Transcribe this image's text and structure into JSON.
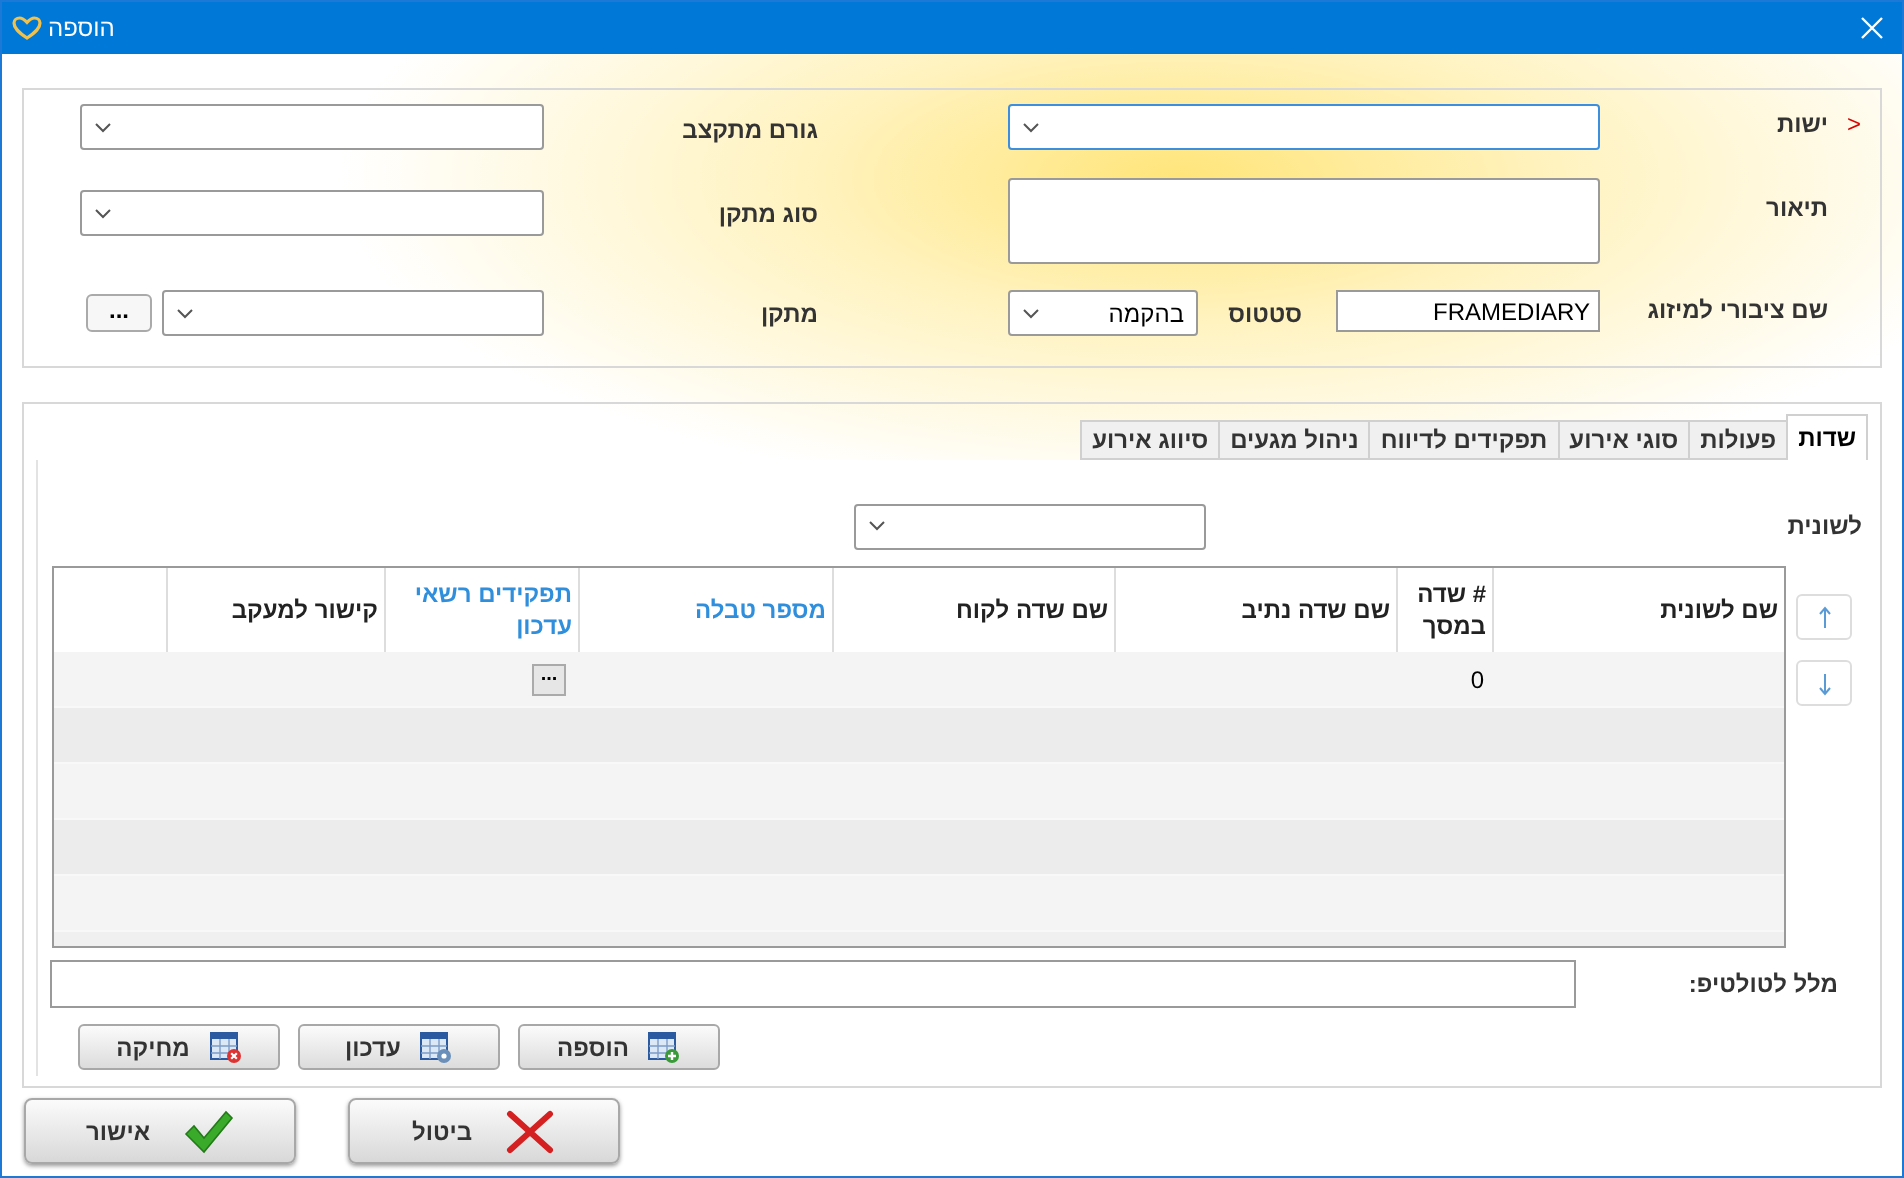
{
  "window": {
    "title": "הוספה"
  },
  "form": {
    "entity": {
      "label": "ישות",
      "marker": "<",
      "focused": true
    },
    "budget_factor": {
      "label": "גורם מתקצב"
    },
    "description": {
      "label": "תיאור"
    },
    "facility_type": {
      "label": "סוג מתקן"
    },
    "public_name": {
      "label": "שם ציבורי למיזוג",
      "value": "FRAMEDIARY"
    },
    "status": {
      "label": "סטטוס",
      "value": "בהקמה"
    },
    "facility": {
      "label": "מתקן",
      "browse": "..."
    }
  },
  "tabs": [
    {
      "label": "שדות",
      "selected": true
    },
    {
      "label": "פעולות",
      "selected": false
    },
    {
      "label": "סוגי אירוע",
      "selected": false
    },
    {
      "label": "תפקידים לדיווח",
      "selected": false
    },
    {
      "label": "ניהול מגעים",
      "selected": false
    },
    {
      "label": "סיווג אירוע",
      "selected": false
    }
  ],
  "tab_filter": {
    "label": "לשונית"
  },
  "grid": {
    "columns": [
      {
        "label": "שם לשונית",
        "color": "#222222"
      },
      {
        "label": "# שדה במסך",
        "color": "#222222"
      },
      {
        "label": "שם שדה נתיב",
        "color": "#222222"
      },
      {
        "label": "שם שדה לקוח",
        "color": "#222222"
      },
      {
        "label": "מספר טבלה",
        "color": "#2f8fdc"
      },
      {
        "label": "תפקידים רשאי עדכון",
        "color": "#2f8fdc"
      },
      {
        "label": "קישור למעקב",
        "color": "#222222"
      }
    ],
    "rows": [
      {
        "kind": "data",
        "cells": [
          {
            "kind": "blank"
          },
          {
            "kind": "text",
            "text": "0"
          },
          {
            "kind": "blank"
          },
          {
            "kind": "blank"
          },
          {
            "kind": "blank"
          },
          {
            "kind": "button",
            "text": "..."
          },
          {
            "kind": "blank"
          }
        ]
      },
      {
        "kind": "empty"
      },
      {
        "kind": "empty"
      },
      {
        "kind": "empty"
      },
      {
        "kind": "empty"
      }
    ]
  },
  "tooltip": {
    "label": "מלל לטולטיפ:"
  },
  "grid_buttons": [
    {
      "label": "הוספה",
      "kind": "add"
    },
    {
      "label": "עדכון",
      "kind": "edit"
    },
    {
      "label": "מחיקה",
      "kind": "delete"
    }
  ],
  "dialog_buttons": [
    {
      "label": "ביטול",
      "kind": "cancel"
    },
    {
      "label": "אישור",
      "kind": "confirm"
    }
  ]
}
